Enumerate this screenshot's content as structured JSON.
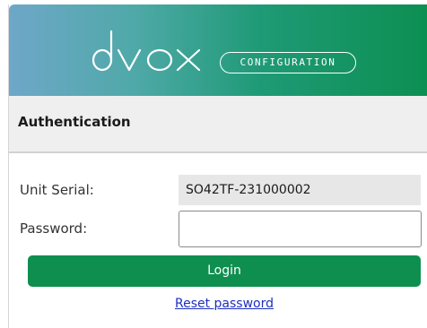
{
  "branding": {
    "logo_text": "dvox",
    "badge_label": "CONFIGURATION",
    "gradient_start": "#6ea7c8",
    "gradient_end": "#0c8f52"
  },
  "auth": {
    "title": "Authentication",
    "serial_label": "Unit Serial:",
    "serial_value": "SO42TF-231000002",
    "password_label": "Password:",
    "password_value": "",
    "password_placeholder": "",
    "login_label": "Login",
    "reset_link_label": "Reset password"
  },
  "colors": {
    "accent": "#0f8f4f",
    "link": "#1f2fbf",
    "header_bg": "#efefef"
  }
}
